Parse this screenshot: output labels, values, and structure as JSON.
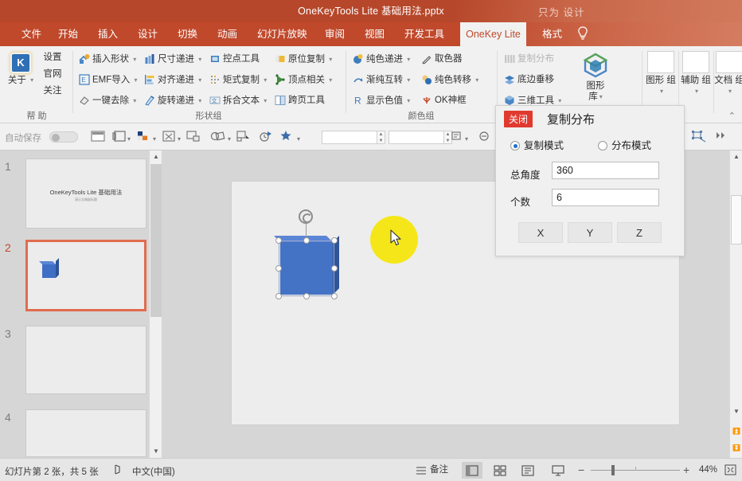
{
  "window": {
    "title": "OneKeyTools Lite 基础用法.pptx",
    "watermark": "只为 设计"
  },
  "tabs": [
    {
      "label": "文件",
      "active": false
    },
    {
      "label": "开始",
      "active": false
    },
    {
      "label": "插入",
      "active": false
    },
    {
      "label": "设计",
      "active": false
    },
    {
      "label": "切换",
      "active": false
    },
    {
      "label": "动画",
      "active": false
    },
    {
      "label": "幻灯片放映",
      "active": false
    },
    {
      "label": "审阅",
      "active": false
    },
    {
      "label": "视图",
      "active": false
    },
    {
      "label": "开发工具",
      "active": false
    },
    {
      "label": "OneKey Lite",
      "active": true
    },
    {
      "label": "格式",
      "active": false
    }
  ],
  "ribbon": {
    "groups": [
      {
        "name": "help",
        "label": "帮 助"
      },
      {
        "name": "shapes",
        "label": "形状组"
      },
      {
        "name": "colors",
        "label": "颜色组"
      },
      {
        "name": "distribute",
        "label": "复制分布"
      }
    ],
    "help": {
      "big_label": "关于",
      "items": [
        "设置",
        "官网",
        "关注"
      ]
    },
    "shapes_items": [
      {
        "label": "插入形状",
        "caret": true,
        "icon": "insert-shape-icon",
        "disabled": false
      },
      {
        "label": "EMF导入",
        "caret": true,
        "icon": "emf-import-icon",
        "disabled": false
      },
      {
        "label": "一键去除",
        "caret": true,
        "icon": "remove-icon",
        "disabled": false
      },
      {
        "label": "尺寸递进",
        "caret": true,
        "icon": "size-step-icon",
        "disabled": false
      },
      {
        "label": "对齐递进",
        "caret": true,
        "icon": "align-step-icon",
        "disabled": false
      },
      {
        "label": "旋转递进",
        "caret": true,
        "icon": "rotate-step-icon",
        "disabled": false
      },
      {
        "label": "控点工具",
        "caret": false,
        "icon": "handle-tool-icon",
        "disabled": false
      },
      {
        "label": "矩式复制",
        "caret": true,
        "icon": "matrix-copy-icon",
        "disabled": false
      },
      {
        "label": "拆合文本",
        "caret": true,
        "icon": "split-text-icon",
        "disabled": false
      },
      {
        "label": "原位复制",
        "caret": true,
        "icon": "in-place-copy-icon",
        "disabled": false
      },
      {
        "label": "顶点相关",
        "caret": true,
        "icon": "vertex-icon",
        "disabled": false
      },
      {
        "label": "跨页工具",
        "caret": false,
        "icon": "cross-page-icon",
        "disabled": false
      }
    ],
    "colors_items": [
      {
        "label": "纯色递进",
        "caret": true,
        "icon": "solid-step-icon",
        "disabled": false
      },
      {
        "label": "渐纯互转",
        "caret": true,
        "icon": "gradient-swap-icon",
        "disabled": false
      },
      {
        "label": "显示色值",
        "caret": true,
        "icon": "show-color-value-icon",
        "disabled": false
      },
      {
        "label": "取色器",
        "caret": false,
        "icon": "eyedropper-icon",
        "disabled": false
      },
      {
        "label": "纯色转移",
        "caret": true,
        "icon": "color-transfer-icon",
        "disabled": false
      },
      {
        "label": "OK神框",
        "caret": false,
        "icon": "ok-box-icon",
        "disabled": false
      }
    ],
    "distribute_items": [
      {
        "label": "复制分布",
        "caret": false,
        "icon": "copy-distribute-icon",
        "disabled": true
      },
      {
        "label": "底边垂移",
        "caret": false,
        "icon": "bottom-shift-icon",
        "disabled": false
      },
      {
        "label": "三维工具",
        "caret": true,
        "icon": "three-d-tools-icon",
        "disabled": false
      }
    ],
    "big_buttons": [
      {
        "line1": "图形",
        "line2": "库",
        "caret": true,
        "name": "shape-library-button"
      },
      {
        "line1": "图形",
        "line2": "组",
        "caret": true,
        "name": "shape-group-button"
      },
      {
        "line1": "辅助",
        "line2": "组",
        "caret": true,
        "name": "assist-group-button"
      },
      {
        "line1": "文档",
        "line2": "组",
        "caret": true,
        "name": "doc-group-button"
      }
    ],
    "status_badge": "关闭",
    "status_label": "复制分布"
  },
  "qat": {
    "autosave_label": "自动保存",
    "icons": [
      "new-slide-icon",
      "layout-icon",
      "theme-color-icon",
      "text-format-icon",
      "picture-icon",
      "shape-merge-icon",
      "duplicate-icon",
      "timing-icon",
      "effects-icon"
    ],
    "field_value": "",
    "field2_value": ""
  },
  "slides": [
    {
      "number": "1",
      "title": "OneKeyTools Lite 基础用法",
      "subtitle": "演示文稿副标题",
      "current": false,
      "has_cube": false
    },
    {
      "number": "2",
      "title": "",
      "subtitle": "",
      "current": true,
      "has_cube": true
    },
    {
      "number": "3",
      "title": "",
      "subtitle": "",
      "current": false,
      "has_cube": false
    },
    {
      "number": "4",
      "title": "",
      "subtitle": "",
      "current": false,
      "has_cube": false
    }
  ],
  "dialog": {
    "close_label": "关闭",
    "title": "复制分布",
    "mode_copy": "复制模式",
    "mode_distribute": "分布模式",
    "mode_selected": "复制模式",
    "angle_label": "总角度",
    "angle_value": "360",
    "count_label": "个数",
    "count_value": "6",
    "axis_buttons": [
      "X",
      "Y",
      "Z"
    ]
  },
  "statusbar": {
    "slide_info": "幻灯片第 2 张，共 5 张",
    "accessibility_icon": "accessibility-icon",
    "language": "中文(中国)",
    "notes_label": "备注",
    "views": [
      "normal-view",
      "slide-sorter-view",
      "reading-view",
      "slideshow-view"
    ],
    "active_view": "normal-view",
    "zoom_minus": "−",
    "zoom_plus": "+",
    "zoom_level": "44%",
    "fit_icon": "fit-to-window-icon"
  },
  "colors": {
    "title_bar": "#b7472a",
    "tabs_bar": "#c0492c",
    "accent_red": "#e03a2f",
    "ribbon_bg": "#f1f1f1",
    "shape_blue": "#4472c4",
    "shape_blue_dark": "#2f5597",
    "highlight_yellow": "#f5e61a",
    "current_slide_border": "#e06c4f",
    "radio_blue": "#1a6fd0"
  }
}
